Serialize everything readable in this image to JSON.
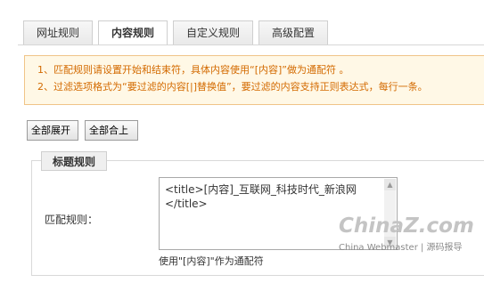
{
  "tabs": [
    {
      "label": "网址规则"
    },
    {
      "label": "内容规则"
    },
    {
      "label": "自定义规则"
    },
    {
      "label": "高级配置"
    }
  ],
  "notice": {
    "line1": "1、匹配规则请设置开始和结束符，具体内容使用“[内容]”做为通配符 。",
    "line2": "2、过滤选项格式为“要过滤的内容[|]替换值”，要过滤的内容支持正则表达式，每行一条。"
  },
  "buttons": {
    "expand_all": "全部展开",
    "collapse_all": "全部合上"
  },
  "section": {
    "legend": "标题规则",
    "match_label": "匹配规则：",
    "match_value": "<title>[内容]_互联网_科技时代_新浪网\n</title>",
    "hint": "使用\"[内容]\"作为通配符"
  },
  "watermark": {
    "logo": "ChinaZ.com",
    "sub": "China Webmaster | 源码报导"
  }
}
